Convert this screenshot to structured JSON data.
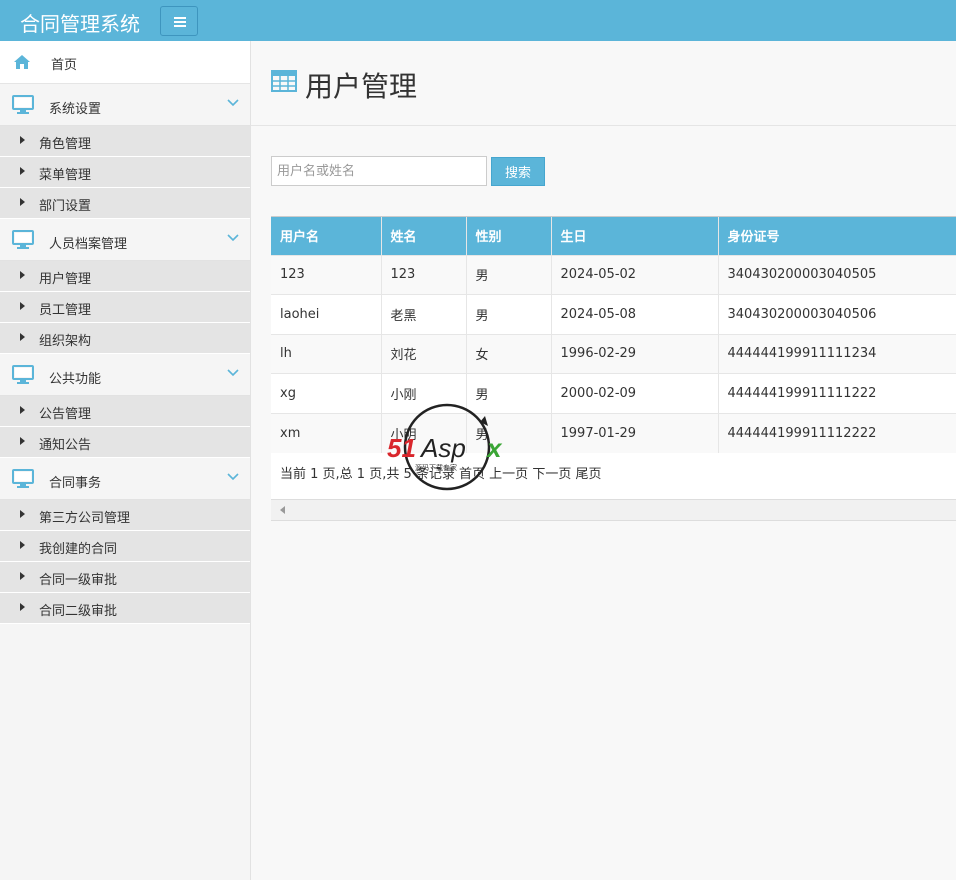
{
  "app": {
    "title": "合同管理系统"
  },
  "sidebar": {
    "home": "首页",
    "groups": [
      {
        "label": "系统设置",
        "items": [
          "角色管理",
          "菜单管理",
          "部门设置"
        ]
      },
      {
        "label": "人员档案管理",
        "items": [
          "用户管理",
          "员工管理",
          "组织架构"
        ]
      },
      {
        "label": "公共功能",
        "items": [
          "公告管理",
          "通知公告"
        ]
      },
      {
        "label": "合同事务",
        "items": [
          "第三方公司管理",
          "我创建的合同",
          "合同一级审批",
          "合同二级审批"
        ]
      }
    ]
  },
  "page": {
    "title": "用户管理"
  },
  "search": {
    "placeholder": "用户名或姓名",
    "value": "",
    "button": "搜索"
  },
  "table": {
    "headers": [
      "用户名",
      "姓名",
      "性别",
      "生日",
      "身份证号"
    ],
    "rows": [
      [
        "123",
        "123",
        "男",
        "2024-05-02",
        "340430200003040505"
      ],
      [
        "laohei",
        "老黑",
        "男",
        "2024-05-08",
        "340430200003040506"
      ],
      [
        "lh",
        "刘花",
        "女",
        "1996-02-29",
        "444444199911111234"
      ],
      [
        "xg",
        "小刚",
        "男",
        "2000-02-09",
        "444444199911111222"
      ],
      [
        "xm",
        "小明",
        "男",
        "1997-01-29",
        "444444199911112222"
      ]
    ]
  },
  "pager": {
    "summary": "当前 1 页,总 1 页,共 5 条记录",
    "first": "首页",
    "prev": "上一页",
    "next": "下一页",
    "last": "尾页"
  },
  "watermark": {
    "text": "51Aspx",
    "subtext": "源码下载专家"
  },
  "colors": {
    "primary": "#5bb5d9",
    "sidebar_item": "#e4e4e4"
  }
}
